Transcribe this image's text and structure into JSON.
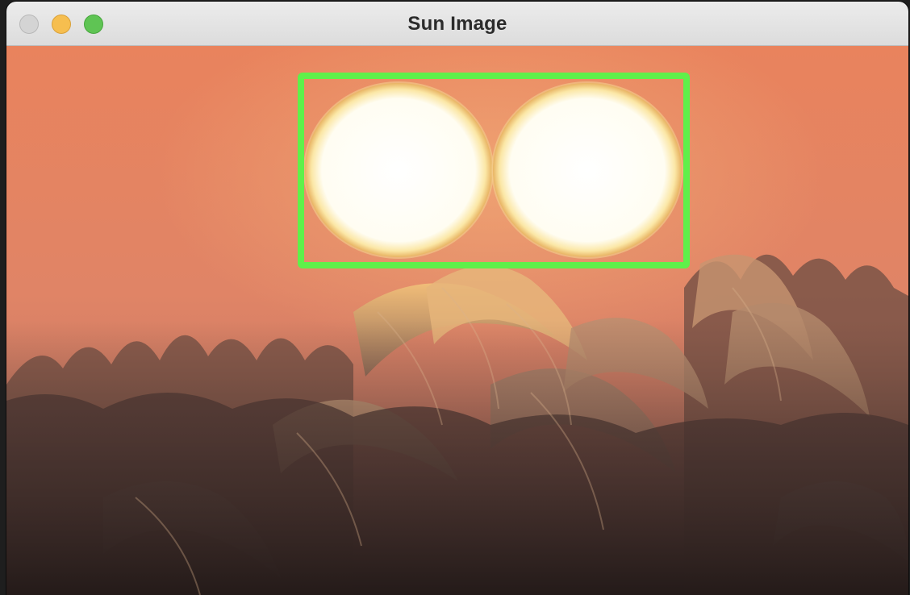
{
  "window": {
    "title": "Sun Image"
  },
  "controls": {
    "close_icon": "close-icon",
    "minimize_icon": "minimize-icon",
    "zoom_icon": "zoom-icon"
  },
  "colors": {
    "sky_top": "#e9825c",
    "sky_bottom": "#d9866f",
    "sun": "#fffbe6",
    "sun_halo": "#f1c879",
    "detection_box": "#5ff04a",
    "grass_dark": "#3a2d2a",
    "grass_light": "#c79a6f"
  }
}
